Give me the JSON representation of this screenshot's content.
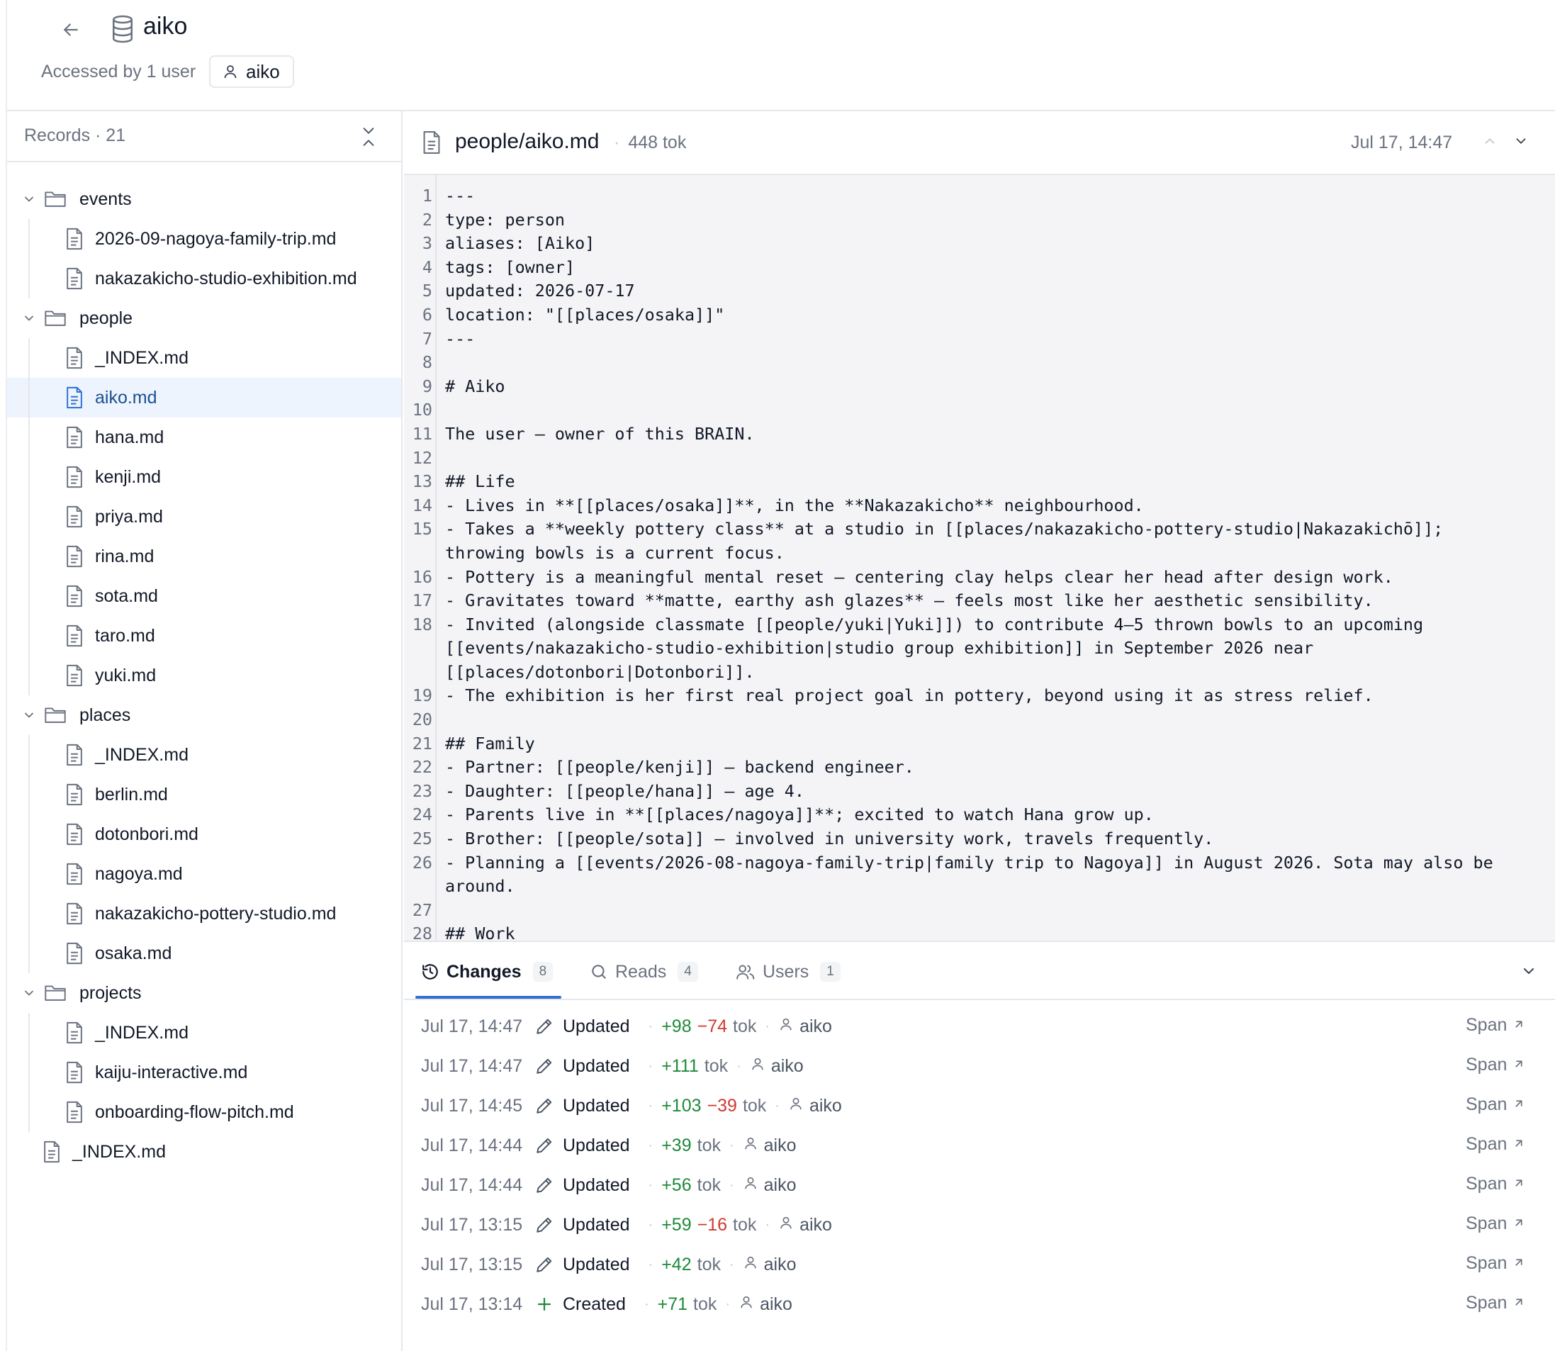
{
  "header": {
    "title": "aiko",
    "accessed_by": "Accessed by 1 user",
    "user_chip": "aiko"
  },
  "sidebar": {
    "records_label": "Records · 21",
    "tree": [
      {
        "type": "folder",
        "name": "events"
      },
      {
        "type": "file",
        "name": "2026-09-nagoya-family-trip.md"
      },
      {
        "type": "file",
        "name": "nakazakicho-studio-exhibition.md"
      },
      {
        "type": "folder",
        "name": "people"
      },
      {
        "type": "file",
        "name": "_INDEX.md"
      },
      {
        "type": "file",
        "name": "aiko.md",
        "selected": true
      },
      {
        "type": "file",
        "name": "hana.md"
      },
      {
        "type": "file",
        "name": "kenji.md"
      },
      {
        "type": "file",
        "name": "priya.md"
      },
      {
        "type": "file",
        "name": "rina.md"
      },
      {
        "type": "file",
        "name": "sota.md"
      },
      {
        "type": "file",
        "name": "taro.md"
      },
      {
        "type": "file",
        "name": "yuki.md"
      },
      {
        "type": "folder",
        "name": "places"
      },
      {
        "type": "file",
        "name": "_INDEX.md"
      },
      {
        "type": "file",
        "name": "berlin.md"
      },
      {
        "type": "file",
        "name": "dotonbori.md"
      },
      {
        "type": "file",
        "name": "nagoya.md"
      },
      {
        "type": "file",
        "name": "nakazakicho-pottery-studio.md"
      },
      {
        "type": "file",
        "name": "osaka.md"
      },
      {
        "type": "folder",
        "name": "projects"
      },
      {
        "type": "file",
        "name": "_INDEX.md"
      },
      {
        "type": "file",
        "name": "kaiju-interactive.md"
      },
      {
        "type": "file",
        "name": "onboarding-flow-pitch.md"
      },
      {
        "type": "rootfile",
        "name": "_INDEX.md"
      }
    ]
  },
  "editor": {
    "filename": "people/aiko.md",
    "tokens": "448 tok",
    "date": "Jul 17, 14:47",
    "lines": [
      {
        "n": "1",
        "t": "---"
      },
      {
        "n": "2",
        "t": "type: person"
      },
      {
        "n": "3",
        "t": "aliases: [Aiko]"
      },
      {
        "n": "4",
        "t": "tags: [owner]"
      },
      {
        "n": "5",
        "t": "updated: 2026-07-17"
      },
      {
        "n": "6",
        "t": "location: \"[[places/osaka]]\""
      },
      {
        "n": "7",
        "t": "---"
      },
      {
        "n": "8",
        "t": ""
      },
      {
        "n": "9",
        "t": "# Aiko"
      },
      {
        "n": "10",
        "t": ""
      },
      {
        "n": "11",
        "t": "The user — owner of this BRAIN."
      },
      {
        "n": "12",
        "t": ""
      },
      {
        "n": "13",
        "t": "## Life"
      },
      {
        "n": "14",
        "t": "- Lives in **[[places/osaka]]**, in the **Nakazakicho** neighbourhood."
      },
      {
        "n": "15",
        "t": "- Takes a **weekly pottery class** at a studio in [[places/nakazakicho-pottery-studio|Nakazakichō]];\nthrowing bowls is a current focus."
      },
      {
        "n": "16",
        "t": "- Pottery is a meaningful mental reset — centering clay helps clear her head after design work."
      },
      {
        "n": "17",
        "t": "- Gravitates toward **matte, earthy ash glazes** — feels most like her aesthetic sensibility."
      },
      {
        "n": "18",
        "t": "- Invited (alongside classmate [[people/yuki|Yuki]]) to contribute 4–5 thrown bowls to an upcoming\n[[events/nakazakicho-studio-exhibition|studio group exhibition]] in September 2026 near\n[[places/dotonbori|Dotonbori]]."
      },
      {
        "n": "19",
        "t": "- The exhibition is her first real project goal in pottery, beyond using it as stress relief."
      },
      {
        "n": "20",
        "t": ""
      },
      {
        "n": "21",
        "t": "## Family"
      },
      {
        "n": "22",
        "t": "- Partner: [[people/kenji]] — backend engineer."
      },
      {
        "n": "23",
        "t": "- Daughter: [[people/hana]] — age 4."
      },
      {
        "n": "24",
        "t": "- Parents live in **[[places/nagoya]]**; excited to watch Hana grow up."
      },
      {
        "n": "25",
        "t": "- Brother: [[people/sota]] — involved in university work, travels frequently."
      },
      {
        "n": "26",
        "t": "- Planning a [[events/2026-08-nagoya-family-trip|family trip to Nagoya]] in August 2026. Sota may also be\naround."
      },
      {
        "n": "27",
        "t": ""
      },
      {
        "n": "28",
        "t": "## Work"
      }
    ]
  },
  "tabs": {
    "changes_label": "Changes",
    "changes_count": "8",
    "reads_label": "Reads",
    "reads_count": "4",
    "users_label": "Users",
    "users_count": "1"
  },
  "changes": [
    {
      "time": "Jul 17, 14:47",
      "action": "Updated",
      "plus": "+98",
      "minus": "−74",
      "tok": "tok",
      "user": "aiko",
      "link": "Span"
    },
    {
      "time": "Jul 17, 14:47",
      "action": "Updated",
      "plus": "+111",
      "minus": "",
      "tok": "tok",
      "user": "aiko",
      "link": "Span"
    },
    {
      "time": "Jul 17, 14:45",
      "action": "Updated",
      "plus": "+103",
      "minus": "−39",
      "tok": "tok",
      "user": "aiko",
      "link": "Span"
    },
    {
      "time": "Jul 17, 14:44",
      "action": "Updated",
      "plus": "+39",
      "minus": "",
      "tok": "tok",
      "user": "aiko",
      "link": "Span"
    },
    {
      "time": "Jul 17, 14:44",
      "action": "Updated",
      "plus": "+56",
      "minus": "",
      "tok": "tok",
      "user": "aiko",
      "link": "Span"
    },
    {
      "time": "Jul 17, 13:15",
      "action": "Updated",
      "plus": "+59",
      "minus": "−16",
      "tok": "tok",
      "user": "aiko",
      "link": "Span"
    },
    {
      "time": "Jul 17, 13:15",
      "action": "Updated",
      "plus": "+42",
      "minus": "",
      "tok": "tok",
      "user": "aiko",
      "link": "Span"
    },
    {
      "time": "Jul 17, 13:14",
      "action": "Created",
      "plus": "+71",
      "minus": "",
      "tok": "tok",
      "user": "aiko",
      "link": "Span"
    }
  ],
  "colors": {
    "accent": "#2f6fd6",
    "selected_bg": "#edf4fd",
    "selected_text": "#1d4f91",
    "added": "#1f8a3b",
    "removed": "#d1392f",
    "code_bg": "#f4f4f6"
  },
  "icons": {
    "back": "arrow-left-icon",
    "database": "database-icon",
    "user": "user-icon",
    "collapse": "collapse-all-icon",
    "folder": "folder-icon",
    "file": "file-icon",
    "chevron": "chevron-down-icon",
    "history": "history-icon",
    "search": "search-icon",
    "users": "users-icon",
    "pencil": "pencil-icon",
    "plus": "plus-icon",
    "external": "arrow-up-right-icon"
  }
}
